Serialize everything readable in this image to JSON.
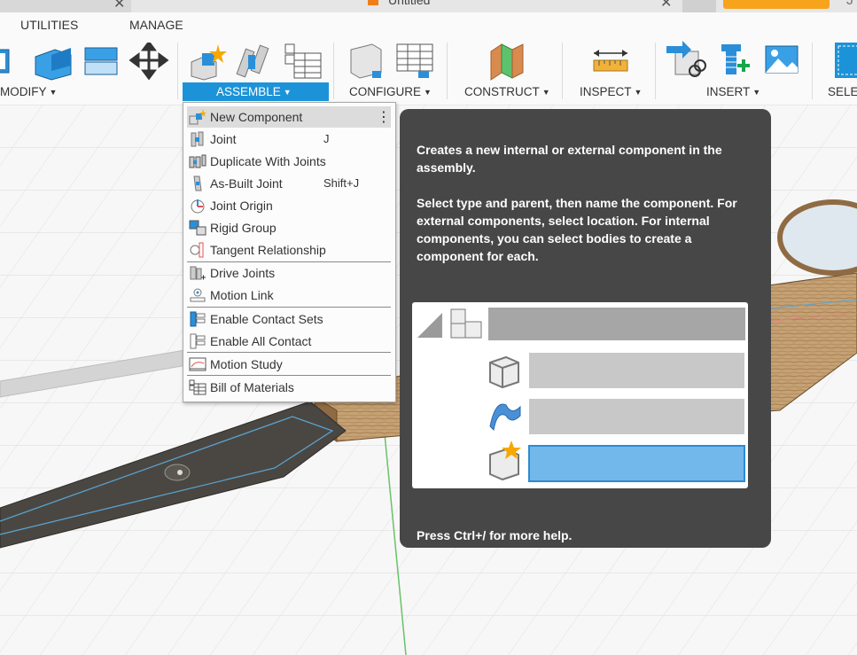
{
  "window": {
    "document_title": "Untitled",
    "user_initial": "J"
  },
  "menu_tabs": {
    "utilities": "UTILITIES",
    "manage": "MANAGE"
  },
  "toolbar_groups": {
    "modify": "MODIFY",
    "assemble": "ASSEMBLE",
    "configure": "CONFIGURE",
    "construct": "CONSTRUCT",
    "inspect": "INSPECT",
    "insert": "INSERT",
    "select": "SELE"
  },
  "assemble_menu": {
    "more_glyph": "⋮",
    "items": [
      {
        "label": "New Component",
        "shortcut": "",
        "icon": "new-component-icon"
      },
      {
        "label": "Joint",
        "shortcut": "J",
        "icon": "joint-icon"
      },
      {
        "label": "Duplicate With Joints",
        "shortcut": "",
        "icon": "duplicate-joints-icon"
      },
      {
        "label": "As-Built Joint",
        "shortcut": "Shift+J",
        "icon": "as-built-joint-icon"
      },
      {
        "label": "Joint Origin",
        "shortcut": "",
        "icon": "joint-origin-icon"
      },
      {
        "label": "Rigid Group",
        "shortcut": "",
        "icon": "rigid-group-icon"
      },
      {
        "label": "Tangent Relationship",
        "shortcut": "",
        "icon": "tangent-relationship-icon"
      },
      {
        "label": "Drive Joints",
        "shortcut": "",
        "icon": "drive-joints-icon"
      },
      {
        "label": "Motion Link",
        "shortcut": "",
        "icon": "motion-link-icon"
      },
      {
        "label": "Enable Contact Sets",
        "shortcut": "",
        "icon": "contact-sets-icon"
      },
      {
        "label": "Enable All Contact",
        "shortcut": "",
        "icon": "all-contact-icon"
      },
      {
        "label": "Motion Study",
        "shortcut": "",
        "icon": "motion-study-icon"
      },
      {
        "label": "Bill of Materials",
        "shortcut": "",
        "icon": "bill-of-materials-icon"
      }
    ]
  },
  "tooltip": {
    "description": "Creates a new internal or external component in the assembly.",
    "instructions": "Select type and parent, then name the component. For external components, select location. For internal components, you can select bodies to create a component for each.",
    "footer": "Press Ctrl+/ for more help."
  },
  "colors": {
    "accent": "#1c93d8",
    "tooltip_bg": "#474747",
    "highlight_field": "#72b8ea",
    "wood": "#c09a6b"
  }
}
